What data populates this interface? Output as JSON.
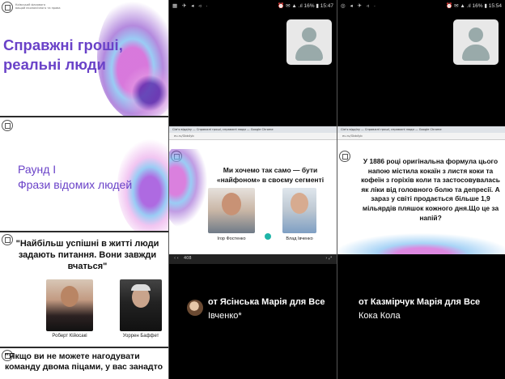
{
  "slides": {
    "slide1": {
      "logo_caption_line1": "Київський фахового",
      "logo_caption_line2": "вищий економічного та права",
      "title": "Справжні гроші, реальні люди"
    },
    "slide2": {
      "title_line1": "Раунд I",
      "title_line2": "Фрази відомих людей"
    },
    "slide3": {
      "quote": "\"Найбільш успішні в житті люди задають питання. Вони завжди вчаться\"",
      "people": [
        "Роберт Кійосакі",
        "Уоррен Баффет"
      ]
    },
    "slide4": {
      "quote": "\"Якщо ви не можете нагодувати команду двома піцами, у вас занадто"
    }
  },
  "phone1": {
    "status_left": "▦ ✈ ◂ ◃ ·",
    "status_right": "⏰ ✉ ▲ .ıl 16% ▮ 15:47",
    "share": {
      "window_title": "Сім'я відділу — Справжні гроші, справжні люди — Google Chrome",
      "url": "eu.ru/Gbb4yb",
      "quote": "Ми хочемо так само — бути «найфоном» в своєму сегменті",
      "people": [
        "Ігор Фостенко",
        "Влад Івченко"
      ],
      "footer_left": "‹ ‹",
      "footer_page": "408",
      "footer_right": "› ⤢"
    },
    "message": {
      "from": "от Ясінська Марія для Все",
      "text": "Івченко*"
    }
  },
  "phone2": {
    "status_left": "◎ ◂ ✈ ◃ ·",
    "status_right": "⏰ ✉ ▲ .ıl 16% ▮ 15:54",
    "share": {
      "window_title": "Сім'я відділу — Справжні гроші, справжні люди — Google Chrome",
      "url": "eu.ru/Gbb4yb",
      "quote": "У 1886 році оригінальна формула цього напою містила кокаїн з листя коки та кофеїн з горіхів коли та застосовувалась як ліки від головного болю та депресії. А зараз у світі продається більше 1,9 мільярдів пляшок кожного дня.Що це за напій?"
    },
    "message": {
      "from": "от Казмірчук Марія для Все",
      "text": "Кока Кола"
    }
  },
  "colors": {
    "accent_purple": "#6a42c8",
    "swirl_pink": "#d46ad8",
    "swirl_blue": "#6fb7f0"
  }
}
